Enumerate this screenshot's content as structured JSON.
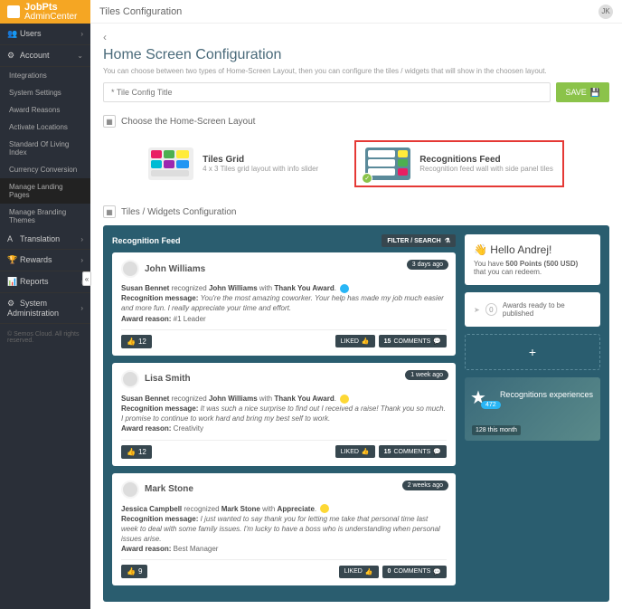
{
  "brand": {
    "name": "JobPts",
    "sub": "AdminCenter"
  },
  "topbar": {
    "title": "Tiles Configuration",
    "user_initials": "JK"
  },
  "sidebar": {
    "users_label": "Users",
    "account_label": "Account",
    "subs": {
      "integrations": "Integrations",
      "system_settings": "System Settings",
      "award_reasons": "Award Reasons",
      "activate_locations": "Activate Locations",
      "standard_of_living": "Standard Of Living Index",
      "currency_conversion": "Currency Conversion",
      "manage_landing": "Manage Landing Pages",
      "manage_branding": "Manage Branding Themes"
    },
    "translation_label": "Translation",
    "rewards_label": "Rewards",
    "reports_label": "Reports",
    "system_admin_label": "System Administration",
    "footer": "© Semos Cloud. All rights reserved.",
    "collapse": "«"
  },
  "page": {
    "back": "‹",
    "title": "Home Screen Configuration",
    "subtitle": "You can choose between two types of Home-Screen Layout, then you can configure the tiles / widgets that will show in the choosen layout.",
    "title_placeholder": "* Tile Config Title",
    "save": "SAVE"
  },
  "section": {
    "choose_layout": "Choose the Home-Screen Layout",
    "tiles_config": "Tiles / Widgets Configuration"
  },
  "layouts": {
    "grid": {
      "title": "Tiles Grid",
      "desc": "4 x 3 Tiles grid layout with info slider"
    },
    "feed": {
      "title": "Recognitions Feed",
      "desc": "Recognition feed wall with side panel tiles"
    }
  },
  "feed": {
    "header": "Recognition Feed",
    "filter": "FILTER / SEARCH",
    "cards": [
      {
        "name": "John Williams",
        "badge": "3 days ago",
        "line": "<b>Susan Bennet</b> recognized <b>John Williams</b> with <b>Thank You Award</b>. <span class='awic' style='background:#29b6f6'></span>",
        "msg": "<b>Recognition message:</b> <i>You're the most amazing coworker. Your help has made my job much easier and more fun. I really appreciate your time and effort.</i>",
        "reason": "<b>Award reason:</b> #1 Leader",
        "likes": "12",
        "liked": "LIKED",
        "c_count": "15",
        "comments": "COMMENTS"
      },
      {
        "name": "Lisa Smith",
        "badge": "1 week ago",
        "line": "<b>Susan Bennet</b> recognized <b>John Williams</b> with <b>Thank You Award</b>. <span class='awic' style='background:#fdd835'></span>",
        "msg": "<b>Recognition message:</b> <i>It was such a nice surprise to find out I received a raise! Thank you so much. I promise to continue to work hard and bring my best self to work.</i>",
        "reason": "<b>Award reason:</b> Creativity",
        "likes": "12",
        "liked": "LIKED",
        "c_count": "15",
        "comments": "COMMENTS"
      },
      {
        "name": "Mark Stone",
        "badge": "2 weeks ago",
        "line": "<b>Jessica Campbell</b> recognized <b>Mark Stone</b> with <b>Appreciate</b>. <span class='awic' style='background:#fdd835'></span>",
        "msg": "<b>Recognition message:</b> <i>I just wanted to say thank you for letting me take that personal time last week to deal with some family issues. I'm lucky to have a boss who is understanding when personal issues arise.</i>",
        "reason": "<b>Award reason:</b> Best Manager",
        "likes": "9",
        "liked": "LIKED",
        "c_count": "0",
        "comments": "COMMENTS"
      }
    ]
  },
  "side": {
    "hello": "Hello Andrej!",
    "points_pre": "You have ",
    "points": "500 Points (500 USD)",
    "points_post": " that you can redeem.",
    "awards_num": "0",
    "awards_text": "Awards ready to be published",
    "add": "+",
    "exp_title": "Recognitions experiences",
    "exp_num": "472",
    "exp_bottom": "128  this month"
  }
}
